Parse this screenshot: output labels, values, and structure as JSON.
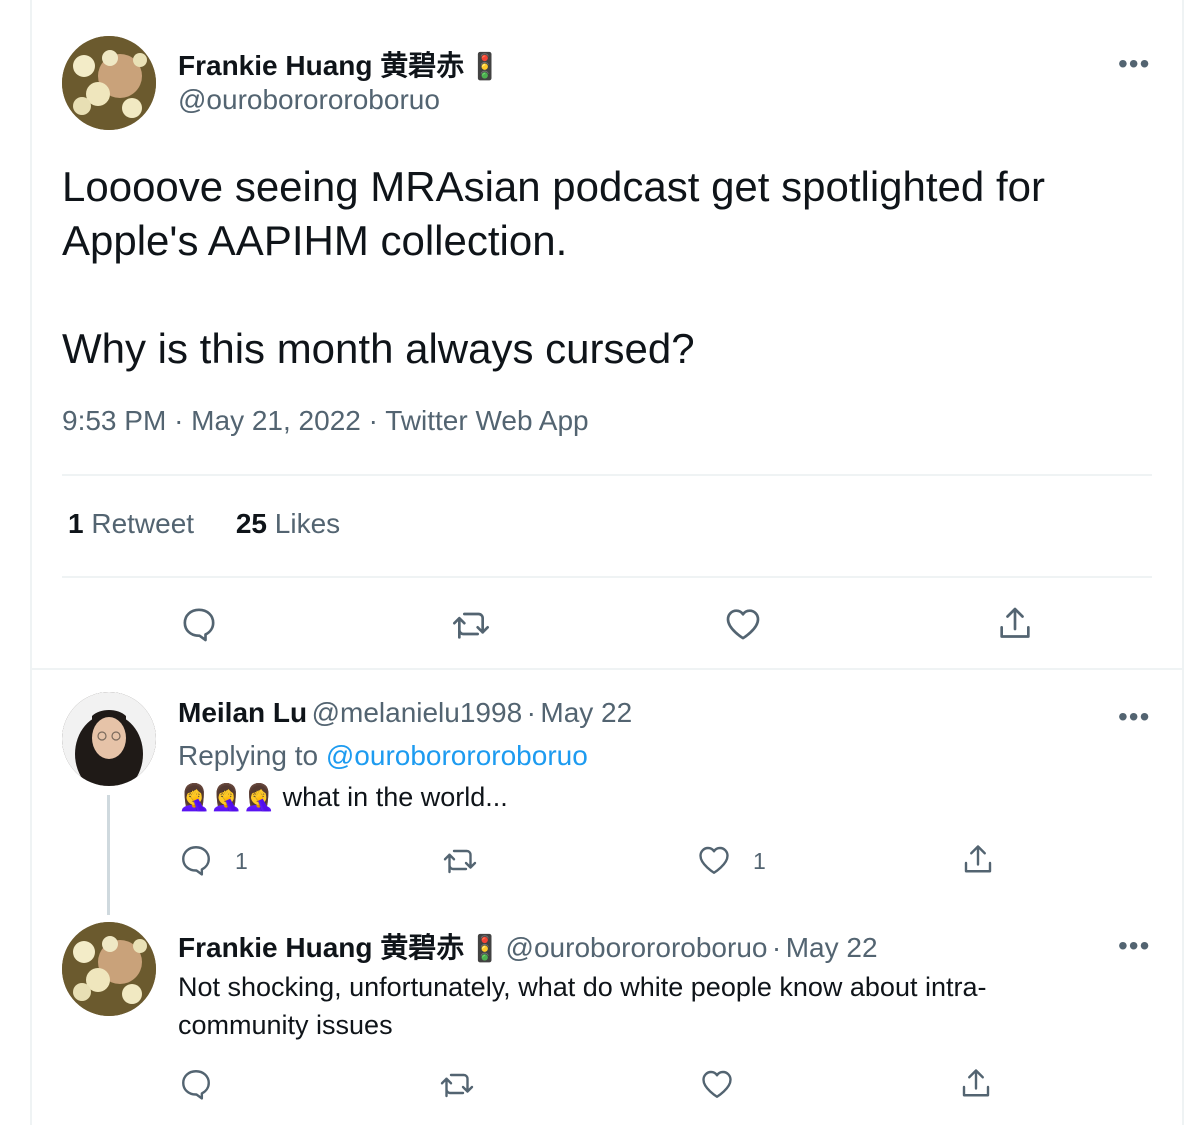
{
  "main_tweet": {
    "author_name": "Frankie Huang 黄碧赤",
    "author_emoji": "🚦",
    "author_handle": "@ouroborororoboruo",
    "text_line1": "Loooove seeing MRAsian podcast get spotlighted for Apple's AAPIHM collection.",
    "text_line2": "Why is this month always cursed?",
    "time": "9:53 PM",
    "date": "May 21, 2022",
    "source": "Twitter Web App",
    "retweets_count": "1",
    "retweets_label": "Retweet",
    "likes_count": "25",
    "likes_label": "Likes",
    "more_label": "•••"
  },
  "reply1": {
    "author_name": "Meilan Lu",
    "author_handle": "@melanielu1998",
    "date": "May 22",
    "replying_label": "Replying to",
    "replying_to": "@ouroborororoboruo",
    "emoji": "🤦‍♀️🤦‍♀️🤦‍♀️",
    "text": "what in the world...",
    "reply_count": "1",
    "like_count": "1",
    "more_label": "•••"
  },
  "reply2": {
    "author_name": "Frankie Huang 黄碧赤",
    "author_emoji": "🚦",
    "author_handle": "@ouroborororoboruo",
    "date": "May 22",
    "text_line1": "Not shocking, unfortunately, what do white people know about intra-",
    "text_line2": "community issues",
    "more_label": "•••"
  },
  "separator": "·",
  "icons": [
    "reply-icon",
    "retweet-icon",
    "like-icon",
    "share-icon",
    "more-icon",
    "avatar"
  ],
  "colors": {
    "text": "#0f1419",
    "secondary": "#536471",
    "link": "#1d9bf0",
    "border": "#eff3f4",
    "avatar_frankie": "#6b5a2e",
    "avatar_meilan": "#2b2420"
  }
}
